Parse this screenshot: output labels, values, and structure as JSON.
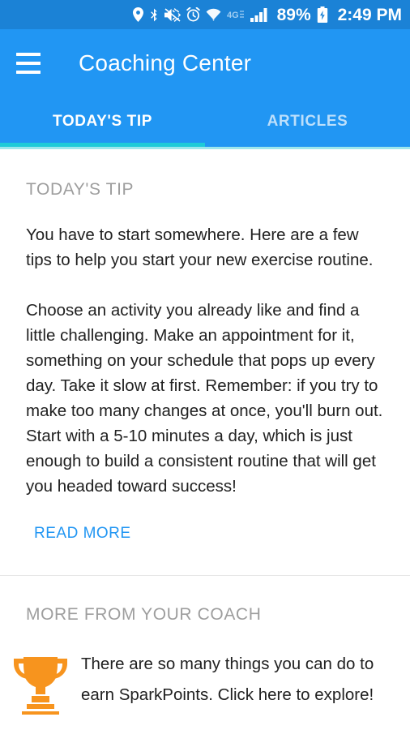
{
  "status_bar": {
    "battery_percent": "89%",
    "time": "2:49 PM",
    "network_label": "4G",
    "icons": [
      "location-icon",
      "bluetooth-icon",
      "volume-mute-icon",
      "alarm-icon",
      "wifi-icon",
      "network-4g-icon",
      "signal-bars-icon",
      "battery-charging-icon"
    ],
    "background_color": "#1B82D6"
  },
  "app_bar": {
    "title": "Coaching Center",
    "menu_icon": "hamburger-menu-icon",
    "background_color": "#2196F3"
  },
  "tabs": {
    "items": [
      {
        "label": "TODAY'S TIP",
        "active": true
      },
      {
        "label": "ARTICLES",
        "active": false
      }
    ],
    "indicator_color": "#1ECBD8"
  },
  "tip": {
    "section_label": "TODAY'S TIP",
    "paragraph_1": "You have to start somewhere. Here are a few tips to help you start your new exercise routine.",
    "paragraph_2": "Choose an activity you already like and find a little challenging. Make an appointment for it, something on your schedule that pops up every day. Take it slow at first. Remember: if you try to make too many changes at once, you'll burn out. Start with a 5-10 minutes a day, which is just enough to build a consistent routine that will get you headed toward success!",
    "read_more_label": "READ MORE",
    "read_more_color": "#2196F3"
  },
  "coach": {
    "section_label": "MORE FROM YOUR COACH",
    "items": [
      {
        "icon": "trophy-icon",
        "icon_color": "#F7941E",
        "text": "There are so many things you can do to earn SparkPoints. Click here to explore!"
      }
    ]
  }
}
